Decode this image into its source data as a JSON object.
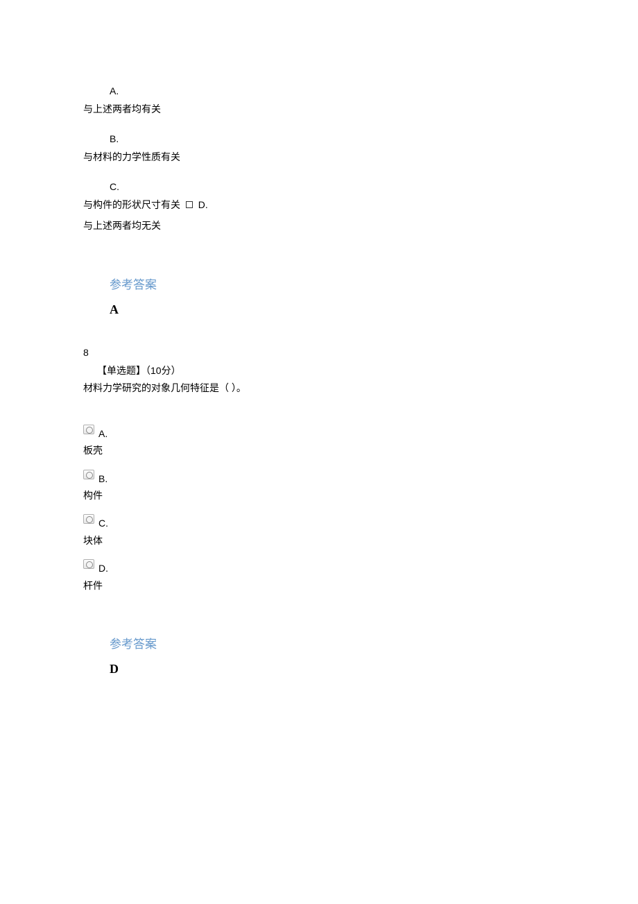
{
  "q7": {
    "options": [
      {
        "letter": "A.",
        "text": "与上述两者均有关"
      },
      {
        "letter": "B.",
        "text": "与材料的力学性质有关"
      },
      {
        "letter": "C.",
        "text": "与构件的形状尺寸有关"
      },
      {
        "letter": "D.",
        "text": "与上述两者均无关"
      }
    ],
    "answer_label": "参考答案",
    "answer_value": "A"
  },
  "q8": {
    "number": "8",
    "type_label": "【单选题】",
    "points_label": "（10分）",
    "stem": "材料力学研究的对象几何特征是（ ）。",
    "options": [
      {
        "letter": "A.",
        "text": "板壳"
      },
      {
        "letter": "B.",
        "text": "构件"
      },
      {
        "letter": "C.",
        "text": "块体"
      },
      {
        "letter": "D.",
        "text": "杆件"
      }
    ],
    "answer_label": "参考答案",
    "answer_value": "D"
  }
}
